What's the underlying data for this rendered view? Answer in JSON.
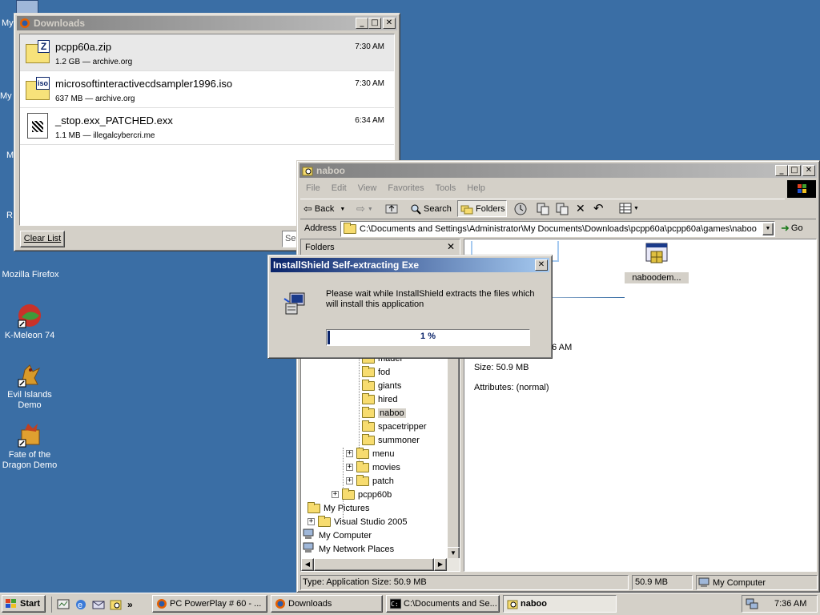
{
  "desktop": {
    "icons": [
      {
        "label": "My",
        "icon": "computer-icon"
      },
      {
        "label": "My",
        "icon": "documents-icon"
      },
      {
        "label": "M",
        "icon": "network-icon"
      },
      {
        "label": "R",
        "icon": "recycle-icon"
      },
      {
        "label": "Mozilla Firefox",
        "icon": "firefox-icon"
      },
      {
        "label": "K-Meleon 74",
        "icon": "kmeleon-icon"
      },
      {
        "label": "Evil Islands Demo",
        "icon": "evil-islands-icon"
      },
      {
        "label": "Fate of the Dragon Demo",
        "icon": "fate-dragon-icon"
      }
    ]
  },
  "downloads": {
    "title": "Downloads",
    "items": [
      {
        "name": "pcpp60a.zip",
        "meta": "1.2 GB — archive.org",
        "time": "7:30 AM",
        "icon": "zip-file-icon"
      },
      {
        "name": "microsoftinteractivecdsampler1996.iso",
        "meta": "637 MB — archive.org",
        "time": "7:30 AM",
        "icon": "iso-file-icon"
      },
      {
        "name": "_stop.exx_PATCHED.exx",
        "meta": "1.1 MB — illegalcybercri.me",
        "time": "6:34 AM",
        "icon": "exe-file-icon"
      }
    ],
    "clear_label": "Clear List",
    "search_partial": "Se"
  },
  "explorer": {
    "title": "naboo",
    "menu": [
      "File",
      "Edit",
      "View",
      "Favorites",
      "Tools",
      "Help"
    ],
    "toolbar": {
      "back": "Back",
      "search": "Search",
      "folders": "Folders"
    },
    "address_label": "Address",
    "address_value": "C:\\Documents and Settings\\Administrator\\My Documents\\Downloads\\pcpp60a\\pcpp60a\\games\\naboo",
    "go_label": "Go",
    "folders_pane_title": "Folders",
    "tree": [
      {
        "label": "mader",
        "indent": 3,
        "expander": false,
        "selected": false
      },
      {
        "label": "fod",
        "indent": 3,
        "expander": false,
        "selected": false
      },
      {
        "label": "giants",
        "indent": 3,
        "expander": false,
        "selected": false
      },
      {
        "label": "hired",
        "indent": 3,
        "expander": false,
        "selected": false
      },
      {
        "label": "naboo",
        "indent": 3,
        "expander": false,
        "selected": true
      },
      {
        "label": "spacetripper",
        "indent": 3,
        "expander": false,
        "selected": false
      },
      {
        "label": "summoner",
        "indent": 3,
        "expander": false,
        "selected": false
      },
      {
        "label": "menu",
        "indent": 2,
        "expander": true,
        "selected": false
      },
      {
        "label": "movies",
        "indent": 2,
        "expander": true,
        "selected": false
      },
      {
        "label": "patch",
        "indent": 2,
        "expander": true,
        "selected": false
      },
      {
        "label": "pcpp60b",
        "indent": 1,
        "expander": true,
        "selected": false
      },
      {
        "label": "My Pictures",
        "indent": 0,
        "expander": false,
        "selected": false
      },
      {
        "label": "Visual Studio 2005",
        "indent": 0,
        "expander": true,
        "selected": false
      },
      {
        "label": "My Computer",
        "indent": -1,
        "expander": false,
        "selected": false
      },
      {
        "label": "My Network Places",
        "indent": -1,
        "expander": false,
        "selected": false
      }
    ],
    "file_label": "naboodem...",
    "details": {
      "modified_partial": ":26 AM",
      "size": "Size: 50.9 MB",
      "attributes": "Attributes: (normal)"
    },
    "status": {
      "left": "Type: Application Size: 50.9 MB",
      "size": "50.9 MB",
      "zone": "My Computer"
    }
  },
  "installshield": {
    "title": "InstallShield Self-extracting Exe",
    "message": "Please wait while InstallShield extracts the files which will install this application",
    "progress_text": "1 %",
    "progress_fraction": 0.01
  },
  "taskbar": {
    "start_label": "Start",
    "buttons": [
      {
        "label": "PC PowerPlay # 60 - ...",
        "active": false
      },
      {
        "label": "Downloads",
        "active": false
      },
      {
        "label": "C:\\Documents and Se...",
        "active": false
      },
      {
        "label": "naboo",
        "active": true
      }
    ],
    "clock": "7:36 AM"
  }
}
